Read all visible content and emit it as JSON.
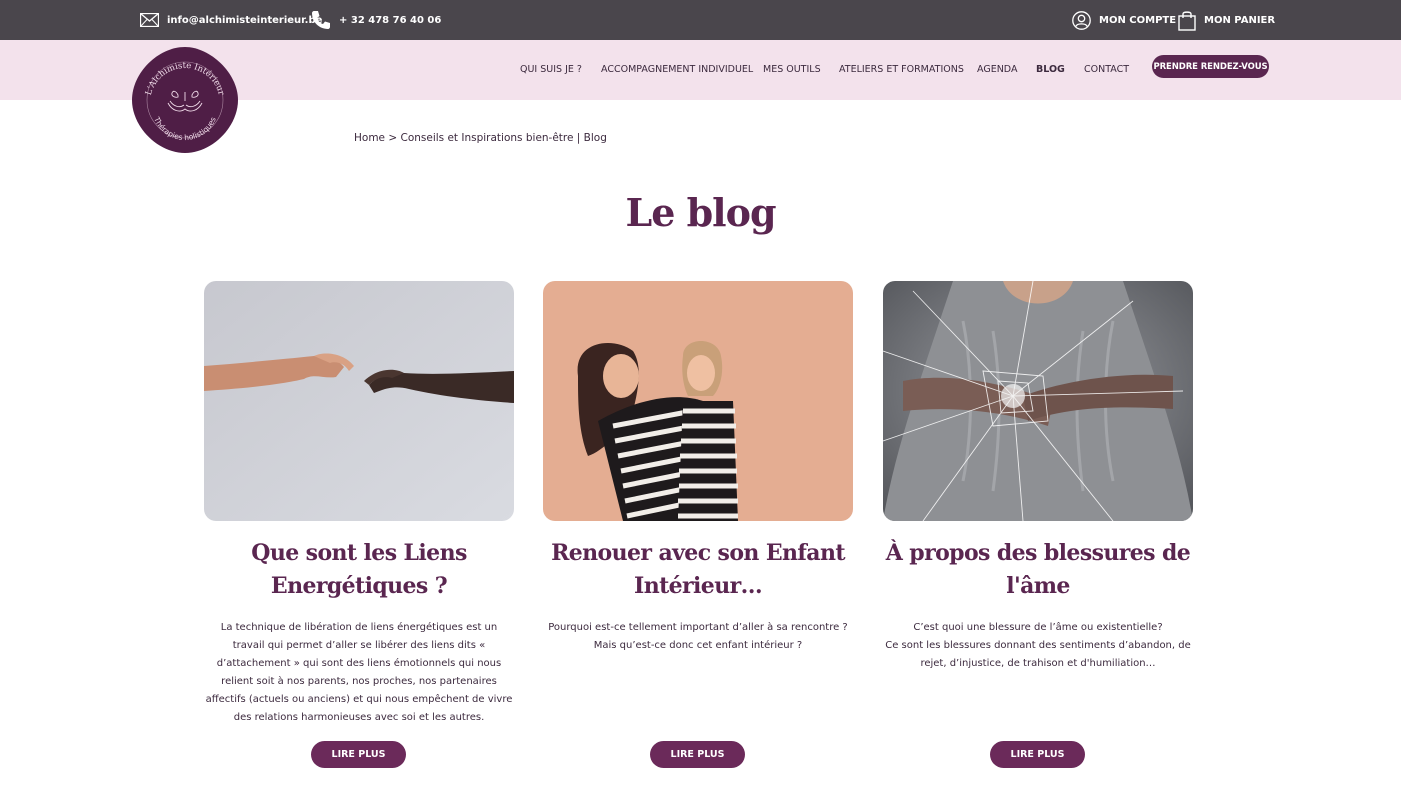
{
  "topbar": {
    "email": "info@alchimisteinterieur.be",
    "phone": "+ 32 478 76 40 06",
    "account": "MON COMPTE",
    "cart": "MON PANIER",
    "icons": [
      "mail-icon",
      "phone-icon",
      "user-icon",
      "shopping-bag-icon"
    ]
  },
  "logo": {
    "title": "L'Alchimiste Intérieur",
    "subtitle": "Thérapies holistiques"
  },
  "nav": {
    "items": [
      "QUI SUIS JE ?",
      "ACCOMPAGNEMENT INDIVIDUEL",
      "MES OUTILS",
      "ATELIERS ET FORMATIONS",
      "AGENDA",
      "BLOG",
      "CONTACT"
    ],
    "active": "BLOG",
    "cta": "PRENDRE RENDEZ-VOUS"
  },
  "breadcrumb": "Home > Conseils et Inspirations bien-être | Blog",
  "page_title": "Le blog",
  "posts": [
    {
      "title": "Que sont les Liens Energétiques ?",
      "description": "La technique de libération de liens énergétiques est un travail qui permet d’aller se libérer des liens dits « d’attachement » qui sont des liens émotionnels qui nous relient soit à nos parents, nos proches, nos partenaires affectifs (actuels ou anciens) et qui nous empêchent de vivre des relations harmonieuses avec soi et les autres.",
      "button": "LIRE PLUS"
    },
    {
      "title": "Renouer avec son Enfant Intérieur…",
      "description": "Pourquoi est-ce tellement important d’aller à sa rencontre ?\nMais qu’est-ce donc cet enfant intérieur ?",
      "button": "LIRE PLUS"
    },
    {
      "title": "À propos des blessures de l'âme",
      "description": "C’est quoi une blessure de l’âme ou existentielle?\nCe sont les blessures donnant des sentiments d’abandon, de rejet, d’injustice, de trahison et d'humiliation…",
      "button": "LIRE PLUS"
    }
  ],
  "colors": {
    "topbar": "#4a464c",
    "navbar": "#f3e2ec",
    "brand": "#5a2650",
    "button": "#6b2a5a"
  }
}
